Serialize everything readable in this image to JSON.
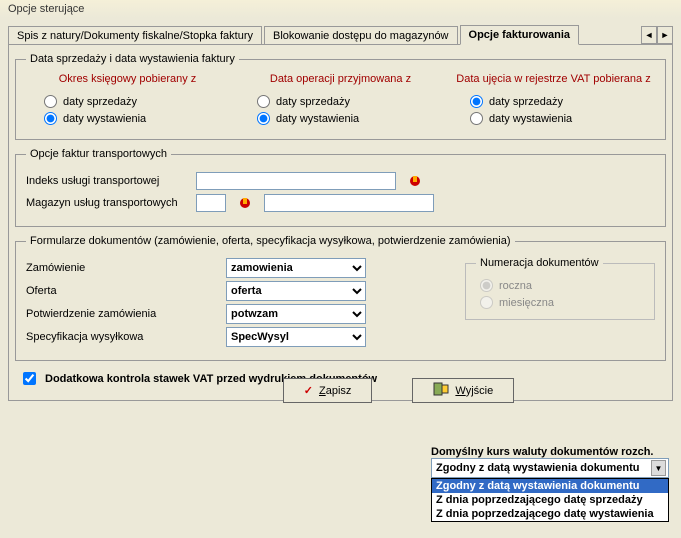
{
  "window_title": "Opcje sterujące",
  "tabs": {
    "t1": "Spis z natury/Dokumenty fiskalne/Stopka faktury",
    "t2": "Blokowanie dostępu do magazynów",
    "t3": "Opcje fakturowania"
  },
  "fs1": {
    "legend": "Data sprzedaży i data wystawienia faktury",
    "col1_head": "Okres księgowy pobierany z",
    "col2_head": "Data operacji przyjmowana z",
    "col3_head": "Data ujęcia w rejestrze VAT pobierana z",
    "opt_sprz": "daty sprzedaży",
    "opt_wyst": "daty wystawienia"
  },
  "fs2": {
    "legend": "Opcje faktur transportowych",
    "row1_label": "Indeks usługi transportowej",
    "row2_label": "Magazyn usług transportowych"
  },
  "fs3": {
    "legend": "Formularze dokumentów (zamówienie, oferta, specyfikacja wysyłkowa, potwierdzenie zamówienia)",
    "r1_label": "Zamówienie",
    "r1_val": "zamowienia",
    "r2_label": "Oferta",
    "r2_val": "oferta",
    "r3_label": "Potwierdzenie zamówienia",
    "r3_val": "potwzam",
    "r4_label": "Specyfikacja wysyłkowa",
    "r4_val": "SpecWysyl",
    "num_legend": "Numeracja dokumentów",
    "num_roczna": "roczna",
    "num_mies": "miesięczna"
  },
  "chk_label": "Dodatkowa kontrola stawek VAT przed wydrukiem dokumentów",
  "combo": {
    "label": "Domyślny kurs waluty dokumentów rozch.",
    "selected": "Zgodny z datą wystawienia dokumentu",
    "opt1": "Zgodny z datą wystawienia dokumentu",
    "opt2": "Z dnia poprzedzającego datę sprzedaży",
    "opt3": "Z dnia poprzedzającego datę wystawienia"
  },
  "btn_save": "Zapisz",
  "btn_save_u": "Z",
  "btn_save_rest": "apisz",
  "btn_exit": "Wyjście",
  "btn_exit_u": "W",
  "btn_exit_rest": "yjście",
  "arrows": {
    "left": "◄",
    "right": "►",
    "down": "▼"
  }
}
